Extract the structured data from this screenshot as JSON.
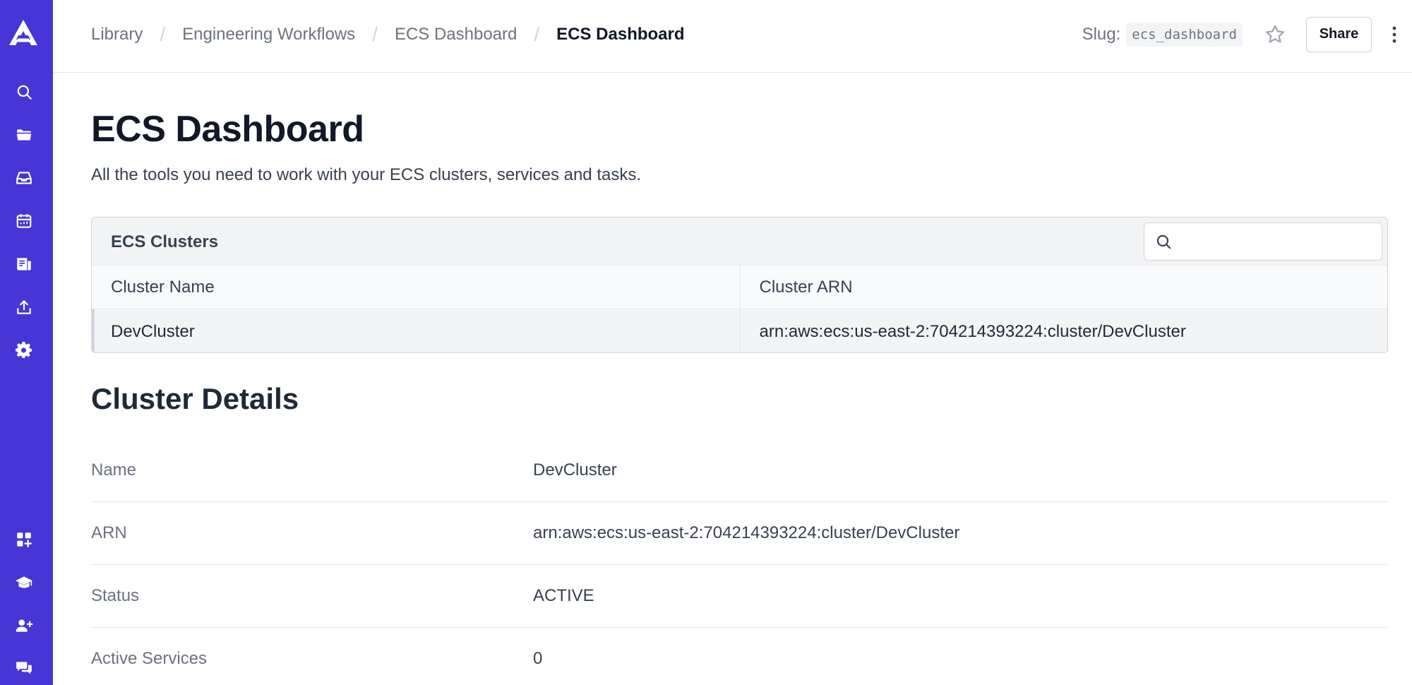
{
  "sidebar": {
    "logo": "app-logo",
    "top_items": [
      {
        "icon": "search-icon"
      },
      {
        "icon": "folder-icon"
      },
      {
        "icon": "inbox-icon"
      },
      {
        "icon": "calendar-icon"
      },
      {
        "icon": "document-icon"
      },
      {
        "icon": "upload-icon"
      },
      {
        "icon": "gear-icon"
      }
    ],
    "bottom_items": [
      {
        "icon": "apps-plus-icon"
      },
      {
        "icon": "graduation-icon"
      },
      {
        "icon": "add-user-icon"
      },
      {
        "icon": "chat-icon"
      }
    ],
    "bg_color": "#4636d6"
  },
  "breadcrumb": [
    "Library",
    "Engineering Workflows",
    "ECS Dashboard",
    "ECS Dashboard"
  ],
  "header": {
    "slug_label": "Slug:",
    "slug_value": "ecs_dashboard",
    "share_label": "Share"
  },
  "page": {
    "title": "ECS Dashboard",
    "description": "All the tools you need to work with your ECS clusters, services and tasks."
  },
  "clusters_table": {
    "title": "ECS Clusters",
    "search_placeholder": "",
    "columns": [
      "Cluster Name",
      "Cluster ARN"
    ],
    "rows": [
      [
        "DevCluster",
        "arn:aws:ecs:us-east-2:704214393224:cluster/DevCluster"
      ]
    ]
  },
  "details": {
    "title": "Cluster Details",
    "rows": [
      {
        "label": "Name",
        "value": "DevCluster"
      },
      {
        "label": "ARN",
        "value": "arn:aws:ecs:us-east-2:704214393224:cluster/DevCluster"
      },
      {
        "label": "Status",
        "value": "ACTIVE"
      },
      {
        "label": "Active Services",
        "value": "0"
      }
    ]
  }
}
